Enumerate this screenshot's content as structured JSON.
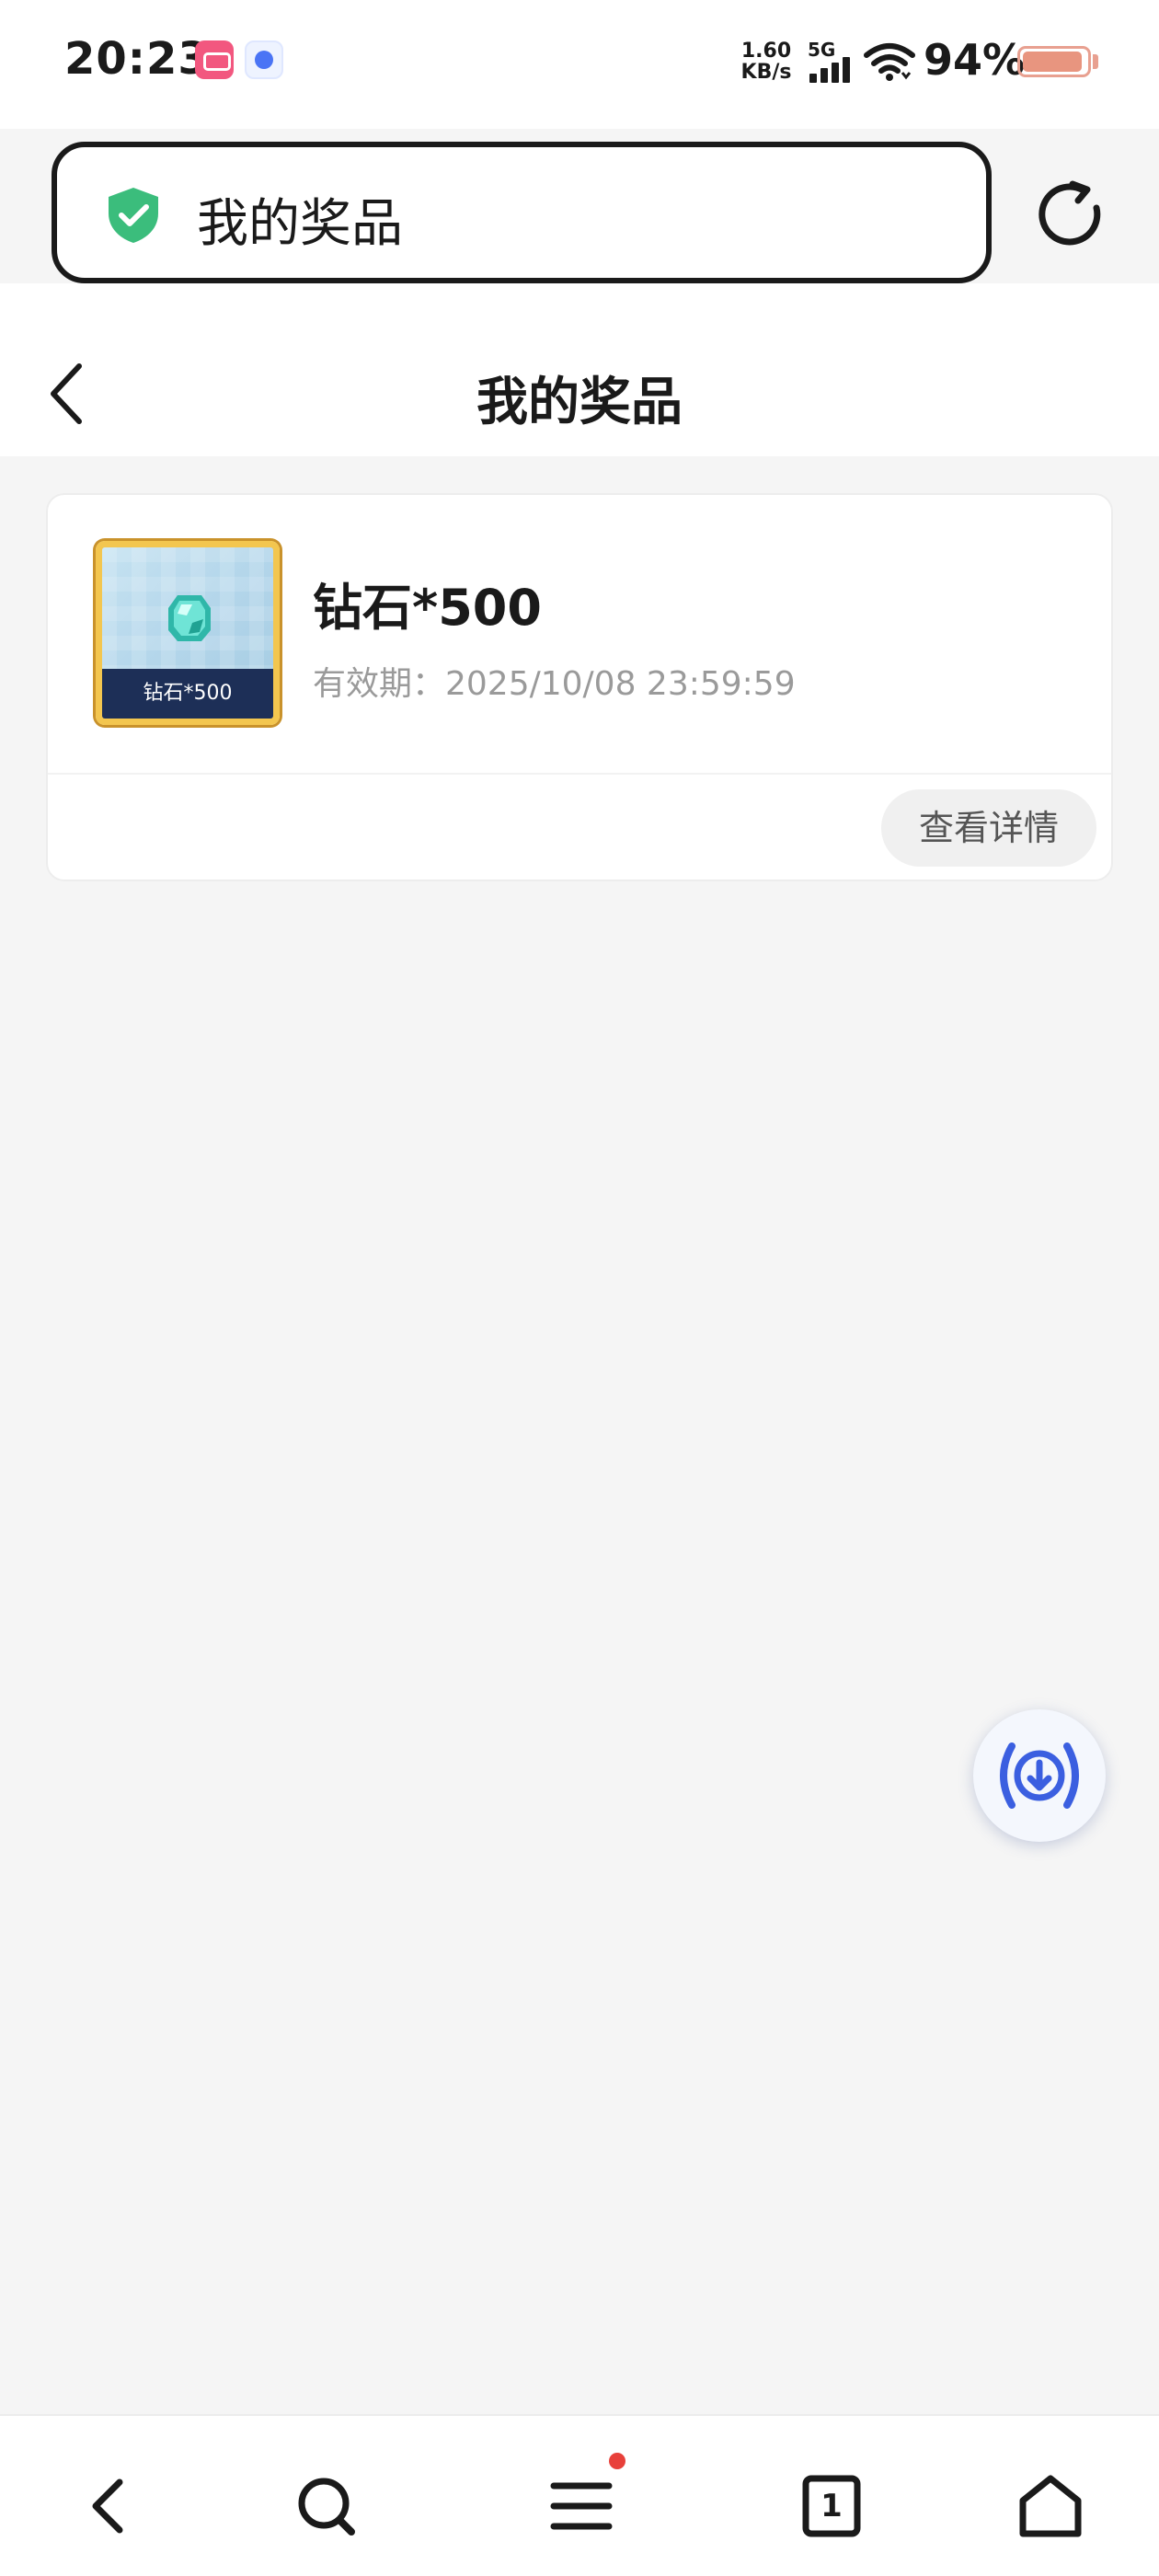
{
  "status_bar": {
    "time": "20:23",
    "network_speed_value": "1.60",
    "network_speed_unit": "KB/s",
    "signal_label": "5G",
    "battery_percent": "94%",
    "battery_level": 0.94,
    "battery_color": "#e8957f"
  },
  "address_bar": {
    "text": "我的奖品",
    "security_icon": "shield-check-icon",
    "security_color": "#3bbd7c",
    "refresh_icon": "refresh-icon"
  },
  "page": {
    "title": "我的奖品",
    "back_icon": "chevron-left-icon"
  },
  "prizes": [
    {
      "name": "钻石*500",
      "thumbnail_caption": "钻石*500",
      "thumbnail_icon": "diamond-icon",
      "expiry": "有效期：2025/10/08 23:59:59",
      "action_label": "查看详情"
    }
  ],
  "floating_button": {
    "icon": "download-broadcast-icon",
    "color": "#3b5fe0"
  },
  "bottom_nav": {
    "items": [
      {
        "icon": "back-icon"
      },
      {
        "icon": "search-icon"
      },
      {
        "icon": "menu-icon",
        "has_notification": true
      },
      {
        "icon": "tabs-icon",
        "count": "1"
      },
      {
        "icon": "home-icon"
      }
    ]
  }
}
